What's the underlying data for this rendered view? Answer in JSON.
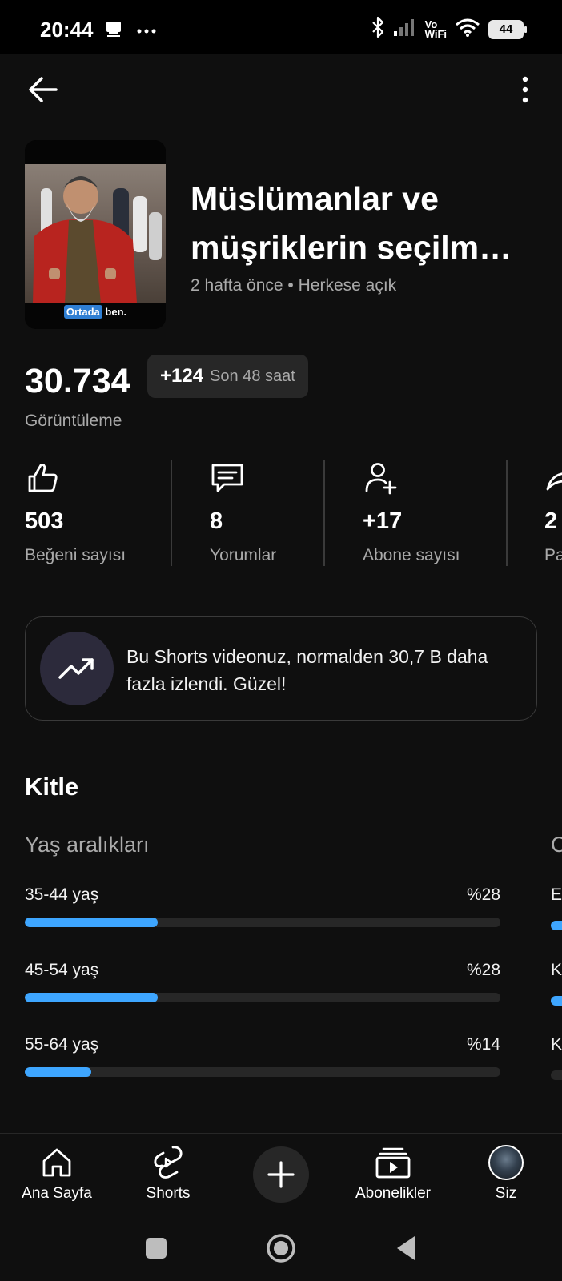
{
  "status_bar": {
    "time": "20:44",
    "icons": [
      "notification-icon",
      "more-notifications-icon",
      "bluetooth-icon",
      "signal-icon",
      "vowifi-icon",
      "wifi-icon",
      "battery-icon"
    ],
    "vowifi_top": "Vo",
    "vowifi_bottom": "WiFi",
    "battery_level": "44"
  },
  "top_bar": {
    "back_icon": "arrow-left-icon",
    "more_icon": "more-vertical-icon"
  },
  "video": {
    "thumbnail_caption_highlight": "Ortada",
    "thumbnail_caption_rest": " ben.",
    "title_line1": "Müslümanlar ve",
    "title_line2": "müşriklerin seçilm…",
    "meta": "2 hafta önce • Herkese açık"
  },
  "views": {
    "count": "30.734",
    "delta": "+124",
    "delta_period": "Son 48 saat",
    "label": "Görüntüleme"
  },
  "stats": [
    {
      "icon": "like-icon",
      "value": "503",
      "label": "Beğeni sayısı"
    },
    {
      "icon": "comment-icon",
      "value": "8",
      "label": "Yorumlar"
    },
    {
      "icon": "add-subscriber-icon",
      "value": "+17",
      "label": "Abone sayısı"
    },
    {
      "icon": "share-icon",
      "value": "2",
      "label": "Pa"
    }
  ],
  "insight": {
    "icon": "trending-up-icon",
    "text": "Bu Shorts videonuz, normalden 30,7 B daha fazla izlendi. Güzel!"
  },
  "audience": {
    "title": "Kitle",
    "age_title": "Yaş aralıkları",
    "next_panel_title_peek": "C",
    "age_groups": [
      {
        "label": "35-44 yaş",
        "percent_label": "%28",
        "share": 0.28
      },
      {
        "label": "45-54 yaş",
        "percent_label": "%28",
        "share": 0.28
      },
      {
        "label": "55-64 yaş",
        "percent_label": "%14",
        "share": 0.14
      }
    ],
    "next_panel_rows_peek": [
      "E",
      "K",
      "K"
    ]
  },
  "bottom_nav": [
    {
      "icon": "home-icon",
      "label": "Ana Sayfa"
    },
    {
      "icon": "shorts-icon",
      "label": "Shorts"
    },
    {
      "icon": "plus-icon",
      "label": ""
    },
    {
      "icon": "subscriptions-icon",
      "label": "Abonelikler"
    },
    {
      "icon": "avatar",
      "label": "Siz"
    }
  ],
  "system_nav": [
    "square-recents-icon",
    "circle-home-icon",
    "triangle-back-icon"
  ],
  "colors": {
    "background": "#0f0f0f",
    "accent_bar": "#3ea6ff",
    "muted_text": "#aaaaaa",
    "chip_bg": "#272727"
  }
}
